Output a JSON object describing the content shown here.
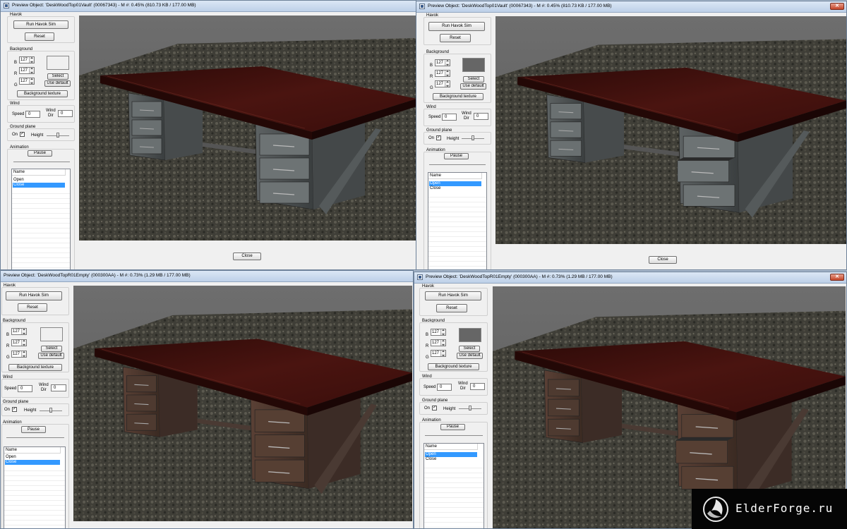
{
  "windows": [
    {
      "title": "Preview Object: 'DeskWoodTop01Vault' (00067343) - M #: 0.45% (810.73 KB / 177.00 MB)",
      "background_color": "#f0f0f0",
      "show_close_x": false,
      "drawer_open": false,
      "desk_style": "metal"
    },
    {
      "title": "Preview Object: 'DeskWoodTop01Vault' (00067343) - M #: 0.45% (810.73 KB / 177.00 MB)",
      "background_color": "#666666",
      "show_close_x": true,
      "drawer_open": true,
      "desk_style": "metal"
    },
    {
      "title": "Preview Object: 'DeskWoodTopR01Empty' (000300AA) - M #: 0.73% (1.29 MB / 177.00 MB)",
      "background_color": "#f0f0f0",
      "show_close_x": false,
      "drawer_open": false,
      "desk_style": "rusty"
    },
    {
      "title": "Preview Object: 'DeskWoodTopR01Empty' (000300AA) - M #: 0.73% (1.29 MB / 177.00 MB)",
      "background_color": "#666666",
      "show_close_x": true,
      "drawer_open": true,
      "desk_style": "rusty"
    }
  ],
  "panel": {
    "havok_label": "Havok",
    "run_havok_sim": "Run Havok Sim",
    "reset": "Reset",
    "background_label": "Background",
    "b_label": "B",
    "r_label": "R",
    "g_label": "G",
    "b_value": "127",
    "r_value": "127",
    "g_value": "127",
    "select": "Select",
    "use_default": "Use default",
    "background_texture": "Background texture",
    "wind_label": "Wind",
    "speed_label": "Speed",
    "speed_value": "0",
    "wind_dir_label_1": "Wind",
    "wind_dir_label_2": "Dir",
    "wind_dir_value": "0",
    "ground_plane_label": "Ground plane",
    "on_label": "On",
    "on_checked": true,
    "height_label": "Height",
    "animation_label": "Animation",
    "pause": "Pause",
    "list_header": "Name",
    "list_items": [
      "Open",
      "Close"
    ]
  },
  "selected_items": [
    "Close",
    "Open",
    "Close",
    "Open"
  ],
  "close_button": "Close",
  "watermark": {
    "text": "ElderForge.ru",
    "icon": "elderforge-logo-icon"
  },
  "colors": {
    "selection": "#3399ff",
    "viewport_sky": "#6b6b6b",
    "ground": "#4a4a40",
    "tabletop": "#4a1410"
  }
}
